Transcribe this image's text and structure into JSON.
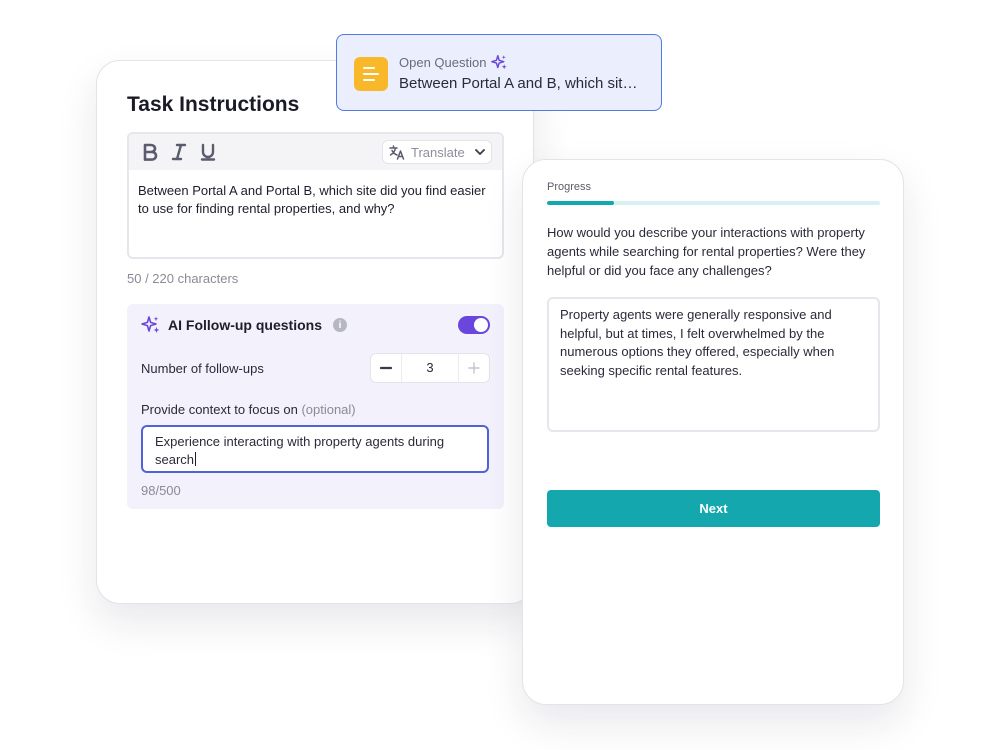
{
  "task_card": {
    "title": "Task Instructions",
    "editor": {
      "toolbar": {
        "bold_icon": "bold-icon",
        "italic_icon": "italic-icon",
        "underline_icon": "underline-icon",
        "translate_label": "Translate"
      },
      "text": "Between Portal A and Portal B, which site did you find easier to use for finding rental properties, and why?"
    },
    "char_count": "50 / 220 characters",
    "ai_followup": {
      "title": "AI Follow-up questions",
      "info_icon": "i",
      "enabled": true,
      "number_label": "Number of follow-ups",
      "number_value": "3",
      "context_label": "Provide context to focus on",
      "context_optional": "(optional)",
      "context_value": "Experience interacting with property agents during search",
      "context_count": "98/500"
    }
  },
  "question_chip": {
    "type_label": "Open Question",
    "text": "Between Portal A and B, which sit…",
    "icon": "text-lines-icon"
  },
  "preview_card": {
    "progress_label": "Progress",
    "progress_fraction": 0.2,
    "question": "How would you describe your interactions with property agents while searching for rental properties? Were they helpful or did you face any challenges?",
    "answer": "Property agents were generally responsive and helpful, but at times, I felt overwhelmed by the numerous options they offered, especially when seeking specific rental features.",
    "next_label": "Next"
  },
  "colors": {
    "accent_purple": "#6a46dc",
    "teal": "#15a7ae",
    "chip_blue": "#4f7be6",
    "chip_icon_yellow": "#f8b82a"
  }
}
